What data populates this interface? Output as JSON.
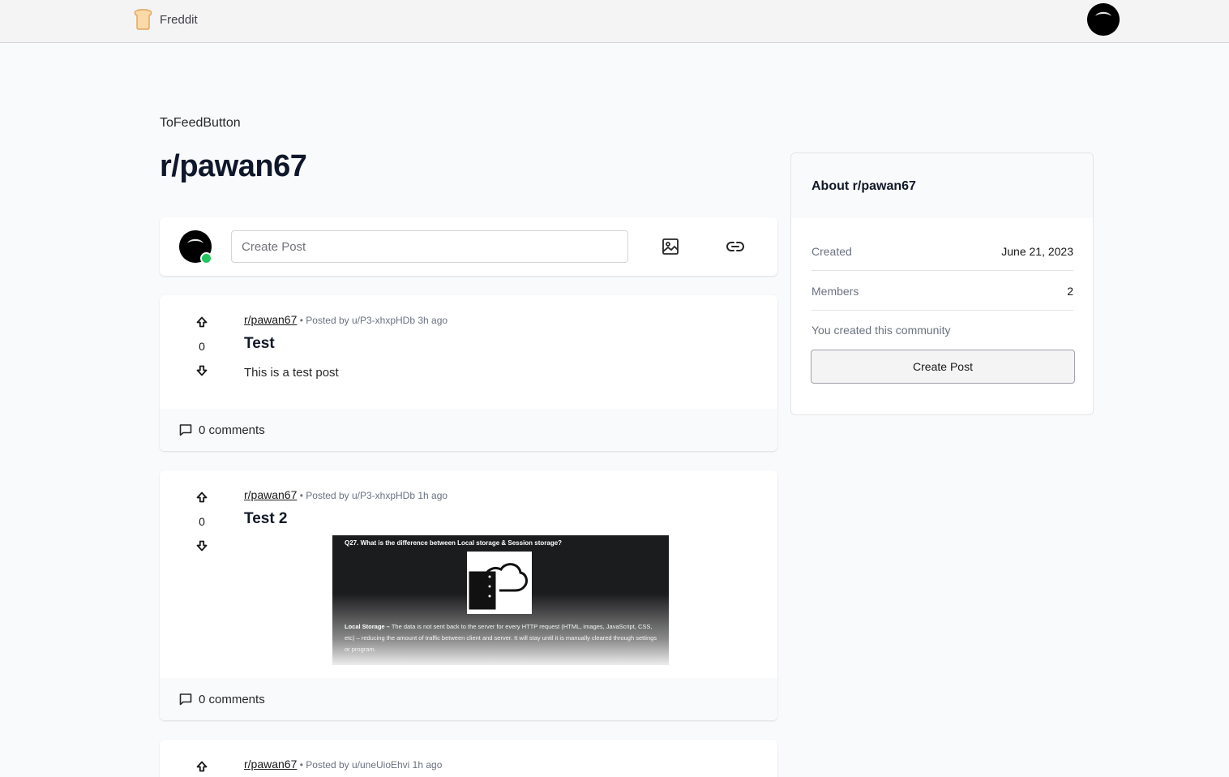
{
  "header": {
    "brand_name": "Freddit",
    "logo_icon": "bread-icon",
    "user_avatar_icon": "avatar-icon"
  },
  "page": {
    "back_label": "ToFeedButton",
    "subreddit_title": "r/pawan67"
  },
  "create_post_bar": {
    "placeholder": "Create Post",
    "image_icon": "image-icon",
    "link_icon": "link-icon",
    "online_color": "#22c55e"
  },
  "posts": [
    {
      "subreddit": "r/pawan67",
      "posted_by": "• Posted by u/P3-xhxpHDb 3h ago",
      "votes": "0",
      "title": "Test",
      "body": "This is a test post",
      "comments": "0 comments"
    },
    {
      "subreddit": "r/pawan67",
      "posted_by": "• Posted by u/P3-xhxpHDb 1h ago",
      "votes": "0",
      "title": "Test 2",
      "image": {
        "heading": "Q27. What is the difference between Local storage & Session storage?",
        "label": "Local Storage –",
        "text": "The data is not sent back to the server for every HTTP request (HTML, images, JavaScript, CSS, etc) – reducing the amount of traffic between client and server. It will stay until it is manually cleared through settings or program."
      },
      "comments": "0 comments"
    },
    {
      "subreddit": "r/pawan67",
      "posted_by": "• Posted by u/uneUioEhvi 1h ago"
    }
  ],
  "sidebar": {
    "title": "About r/pawan67",
    "created_label": "Created",
    "created_value": "June 21, 2023",
    "members_label": "Members",
    "members_value": "2",
    "note": "You created this community",
    "button_label": "Create Post"
  }
}
